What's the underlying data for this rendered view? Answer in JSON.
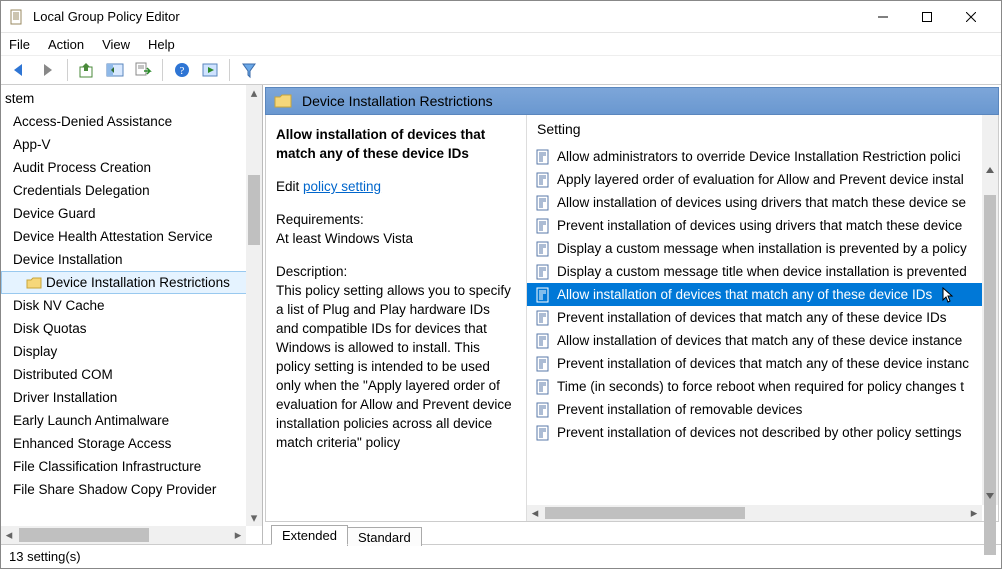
{
  "window": {
    "title": "Local Group Policy Editor"
  },
  "menubar": {
    "items": [
      "File",
      "Action",
      "View",
      "Help"
    ]
  },
  "tree": {
    "top_partial": "stem",
    "items": [
      "Access-Denied Assistance",
      "App-V",
      "Audit Process Creation",
      "Credentials Delegation",
      "Device Guard",
      "Device Health Attestation Service",
      "Device Installation",
      "Device Installation Restrictions",
      "Disk NV Cache",
      "Disk Quotas",
      "Display",
      "Distributed COM",
      "Driver Installation",
      "Early Launch Antimalware",
      "Enhanced Storage Access",
      "File Classification Infrastructure",
      "File Share Shadow Copy Provider"
    ],
    "selected_index": 7
  },
  "header": {
    "title": "Device Installation Restrictions"
  },
  "description": {
    "policy_title": "Allow installation of devices that match any of these device IDs",
    "edit_prefix": "Edit ",
    "edit_link": "policy setting",
    "req_label": "Requirements:",
    "req_value": "At least Windows Vista",
    "desc_label": "Description:",
    "desc_body": "This policy setting allows you to specify a list of Plug and Play hardware IDs and compatible IDs for devices that Windows is allowed to install. This policy setting is intended to be used only when the \"Apply layered order of evaluation for Allow and Prevent device installation policies across all device match criteria\" policy"
  },
  "list": {
    "column": "Setting",
    "selected_index": 6,
    "items": [
      "Allow administrators to override Device Installation Restriction polici",
      "Apply layered order of evaluation for Allow and Prevent device instal",
      "Allow installation of devices using drivers that match these device se",
      "Prevent installation of devices using drivers that match these device",
      "Display a custom message when installation is prevented by a policy",
      "Display a custom message title when device installation is prevented",
      "Allow installation of devices that match any of these device IDs",
      "Prevent installation of devices that match any of these device IDs",
      "Allow installation of devices that match any of these device instance",
      "Prevent installation of devices that match any of these device instanc",
      "Time (in seconds) to force reboot when required for policy changes t",
      "Prevent installation of removable devices",
      "Prevent installation of devices not described by other policy settings"
    ]
  },
  "tabs": {
    "items": [
      "Extended",
      "Standard"
    ],
    "active_index": 0
  },
  "statusbar": {
    "text": "13 setting(s)"
  }
}
